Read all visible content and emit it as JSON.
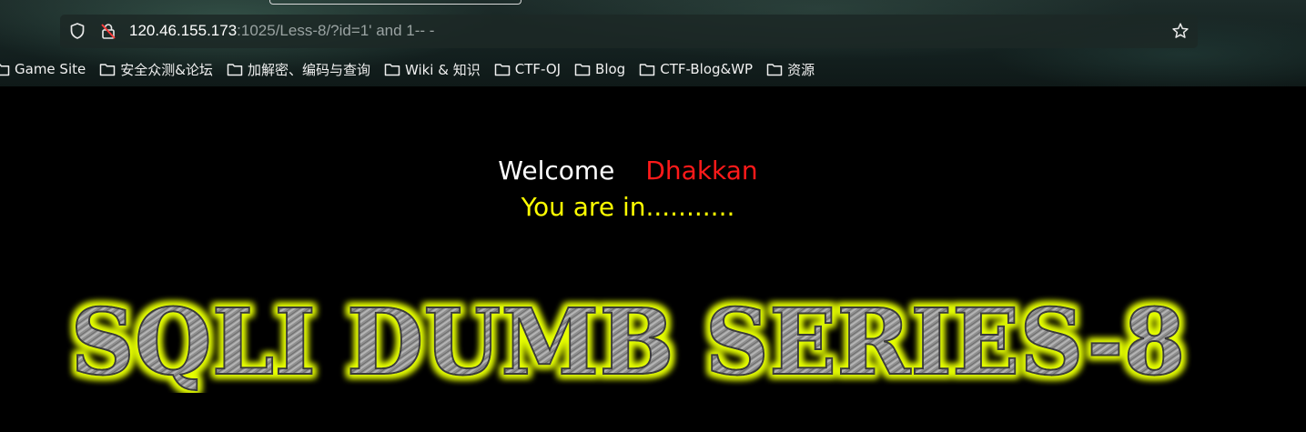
{
  "browser": {
    "url": {
      "host": "120.46.155.173",
      "rest": ":1025/Less-8/?id=1' and 1-- -"
    },
    "bookmarks": [
      {
        "label": "Game Site"
      },
      {
        "label": "安全众测&论坛"
      },
      {
        "label": "加解密、编码与查询"
      },
      {
        "label": "Wiki & 知识"
      },
      {
        "label": "CTF-OJ"
      },
      {
        "label": "Blog"
      },
      {
        "label": "CTF-Blog&WP"
      },
      {
        "label": "资源"
      }
    ]
  },
  "page": {
    "welcome": "Welcome",
    "name": "Dhakkan",
    "status": "You are in...........",
    "banner_title": "SQLI DUMB SERIES-8"
  },
  "colors": {
    "welcome": "#ffffff",
    "name": "#ff1a1a",
    "status": "#ffff00",
    "banner_glow": "#e6ff00"
  },
  "icons": [
    "shield-icon",
    "insecure-lock-icon",
    "star-icon",
    "folder-icon"
  ]
}
